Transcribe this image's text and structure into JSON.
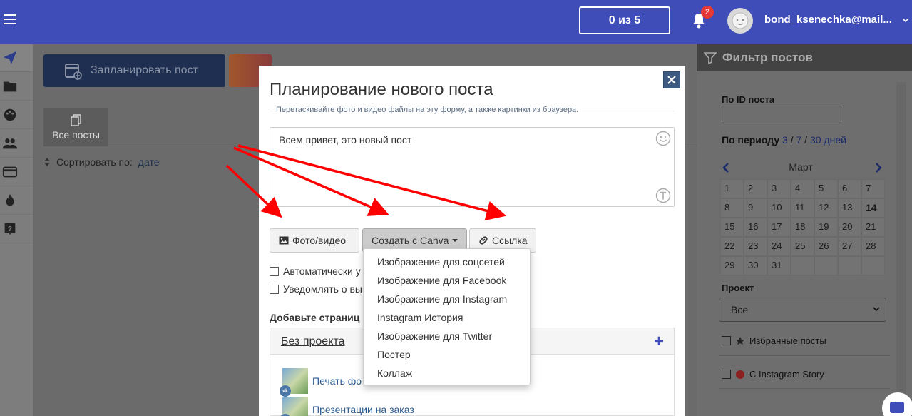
{
  "topbar": {
    "counter": "0 из 5",
    "notification_count": "2",
    "username": "bond_ksenechka@mail...",
    "accent": "#3f4db8"
  },
  "sidebar": {
    "items": [
      {
        "icon": "paper-plane-icon",
        "active": true
      },
      {
        "icon": "folder-icon"
      },
      {
        "icon": "palette-icon"
      },
      {
        "icon": "users-icon"
      },
      {
        "icon": "credit-card-icon"
      },
      {
        "icon": "fire-icon"
      },
      {
        "icon": "help-icon"
      }
    ]
  },
  "main": {
    "plan_button": "Запланировать пост",
    "tab_all": "Все посты",
    "sort_label": "Сортировать по:",
    "sort_value": "дате"
  },
  "filter": {
    "title": "Фильтр постов",
    "by_id_label": "По ID поста",
    "period_label": "По периоду",
    "period_3": "3",
    "period_7": "7",
    "period_30": "30",
    "period_unit": "дней",
    "month": "Март",
    "days": [
      "1",
      "2",
      "3",
      "4",
      "5",
      "6",
      "7",
      "8",
      "9",
      "10",
      "11",
      "12",
      "13",
      "14",
      "15",
      "16",
      "17",
      "18",
      "19",
      "20",
      "21",
      "22",
      "23",
      "24",
      "25",
      "26",
      "27",
      "28",
      "29",
      "30",
      "31"
    ],
    "today": "14",
    "project_label": "Проект",
    "project_value": "Все",
    "favorites_label": "Избранные посты",
    "story_label": "С Instagram Story"
  },
  "modal": {
    "title": "Планирование нового поста",
    "hint": "Перетаскивайте фото и видео файлы на эту форму, а также картинки из браузера.",
    "post_text": "Всем привет, это новый пост",
    "photo_button": "Фото/видео",
    "canva_button": "Создать с Canva",
    "link_button": "Ссылка",
    "auto_check": "Автоматически у",
    "notify_check": "Уведомлять о вы",
    "add_pages": "Добавьте страниц",
    "project_name": "Без проекта",
    "pages": [
      {
        "name": "Печать фо"
      },
      {
        "name": "Презентации на заказ"
      }
    ]
  },
  "canva_menu": {
    "items": [
      "Изображение для соцсетей",
      "Изображение для Facebook",
      "Изображение для Instagram",
      "Instagram История",
      "Изображение для Twitter",
      "Постер",
      "Коллаж"
    ]
  }
}
